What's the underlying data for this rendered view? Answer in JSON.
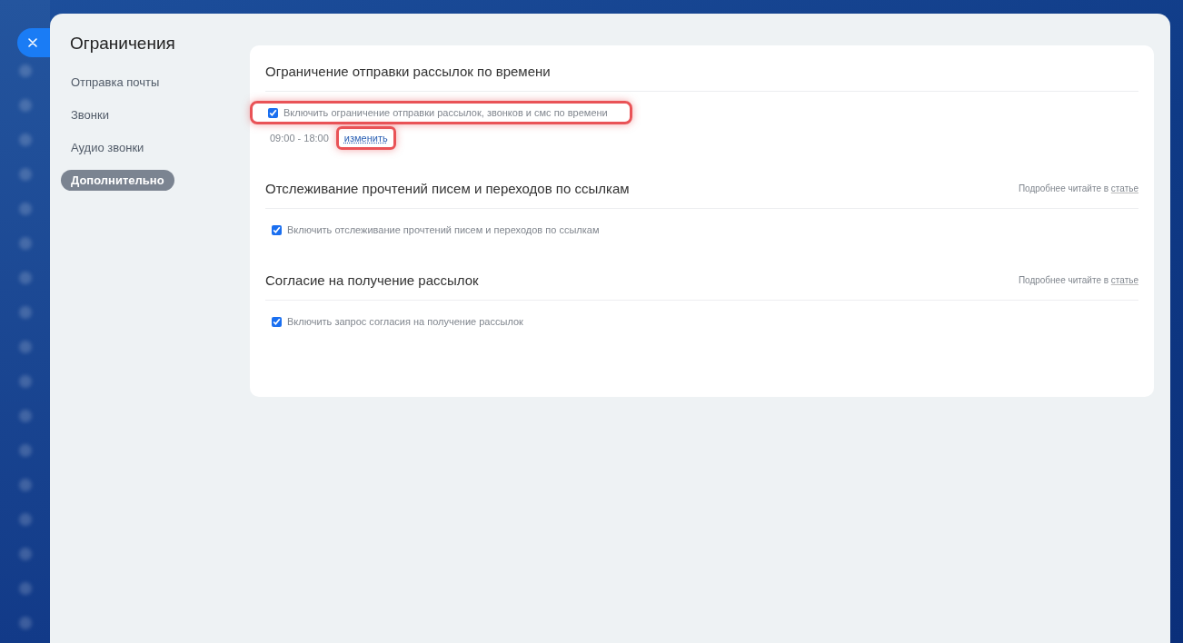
{
  "panel": {
    "title": "Ограничения"
  },
  "sidebar": {
    "items": [
      {
        "label": "Отправка почты",
        "selected": false
      },
      {
        "label": "Звонки",
        "selected": false
      },
      {
        "label": "Аудио звонки",
        "selected": false
      },
      {
        "label": "Дополнительно",
        "selected": true
      }
    ]
  },
  "sections": [
    {
      "title": "Ограничение отправки рассылок по времени",
      "option": {
        "label": "Включить ограничение отправки рассылок, звонков и смс по времени",
        "checked": true,
        "highlighted": true
      },
      "schedule": {
        "time": "09:00 - 18:00",
        "link": "изменить",
        "highlighted": true
      }
    },
    {
      "title": "Отслеживание прочтений писем и переходов по ссылкам",
      "note": {
        "text": "Подробнее читайте в",
        "link": "статье"
      },
      "option": {
        "label": "Включить отслеживание прочтений писем и переходов по ссылкам",
        "checked": true,
        "highlighted": false
      }
    },
    {
      "title": "Согласие на получение рассылок",
      "note": {
        "text": "Подробнее читайте в",
        "link": "статье"
      },
      "option": {
        "label": "Включить запрос согласия на получение рассылок",
        "checked": true,
        "highlighted": false
      }
    }
  ]
}
